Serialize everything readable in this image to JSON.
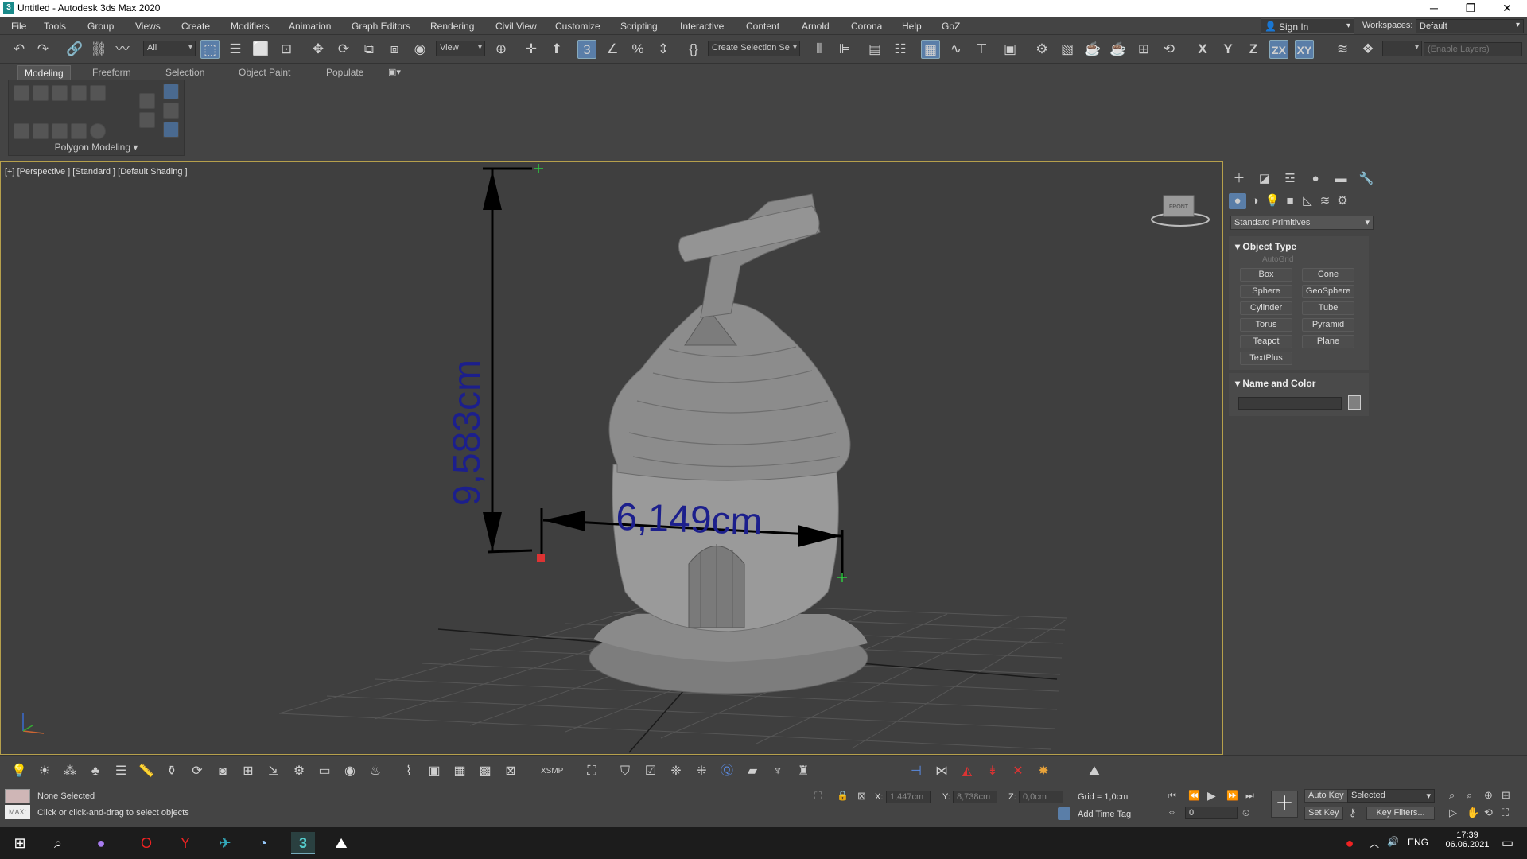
{
  "window": {
    "title": "Untitled - Autodesk 3ds Max 2020",
    "app_icon": "3"
  },
  "menu": [
    "File",
    "Tools",
    "Group",
    "Views",
    "Create",
    "Modifiers",
    "Animation",
    "Graph Editors",
    "Rendering",
    "Civil View",
    "Customize",
    "Scripting",
    "Interactive",
    "Content",
    "Arnold",
    "Corona",
    "Help",
    "GoZ"
  ],
  "account": {
    "sign_in": "Sign In",
    "workspaces_label": "Workspaces:",
    "workspace_value": "Default"
  },
  "toolbar": {
    "filter_value": "All",
    "view_value": "View",
    "selection_set_placeholder": "Create Selection Se",
    "axis_x": "X",
    "axis_y": "Y",
    "axis_z": "Z",
    "axis_zx": "ZX",
    "axis_xy": "XY",
    "layers_placeholder": "(Enable Layers)"
  },
  "ribbon": {
    "tabs": [
      "Modeling",
      "Freeform",
      "Selection",
      "Object Paint",
      "Populate"
    ],
    "active_tab": "Modeling",
    "panel_label": "Polygon Modeling"
  },
  "viewport": {
    "label": "[+] [Perspective ] [Standard ] [Default Shading ]",
    "dim_height": "9,583cm",
    "dim_width": "6,149cm",
    "viewcube_label": "FRONT"
  },
  "command_panel": {
    "category": "Standard Primitives",
    "object_type_header": "Object Type",
    "autogrid": "AutoGrid",
    "buttons": [
      "Box",
      "Cone",
      "Sphere",
      "GeoSphere",
      "Cylinder",
      "Tube",
      "Torus",
      "Pyramid",
      "Teapot",
      "Plane",
      "TextPlus"
    ],
    "name_color_header": "Name and Color",
    "color_swatch": "#808080"
  },
  "status": {
    "maxscript_label": "MAX:",
    "selection": "None Selected",
    "prompt": "Click or click-and-drag to select objects",
    "x_label": "X:",
    "x_value": "1,447cm",
    "y_label": "Y:",
    "y_value": "8,738cm",
    "z_label": "Z:",
    "z_value": "0,0cm",
    "grid": "Grid = 1,0cm",
    "add_time_tag": "Add Time Tag",
    "auto_key": "Auto Key",
    "auto_key_mode": "Selected",
    "set_key": "Set Key",
    "key_filters": "Key Filters...",
    "frame": "0",
    "xsmp": "XSMP"
  },
  "taskbar": {
    "lang": "ENG",
    "time": "17:39",
    "date": "06.06.2021"
  }
}
